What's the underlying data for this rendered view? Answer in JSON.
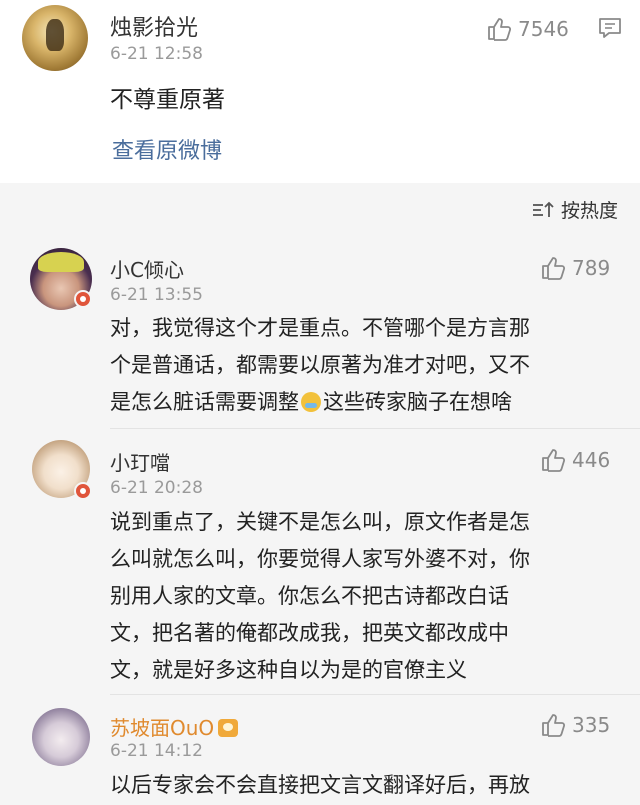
{
  "main_post": {
    "username": "烛影拾光",
    "timestamp": "6-21 12:58",
    "likes": "7546",
    "text": "不尊重原著",
    "view_original": "查看原微博"
  },
  "sort": {
    "label": "按热度"
  },
  "comments": [
    {
      "username": "小C倾心",
      "timestamp": "6-21 13:55",
      "likes": "789",
      "text_lines": [
        "对，我觉得这个才是重点。不管哪个是方言那",
        "个是普通话，都需要以原著为准才对吧，又不",
        "是怎么脏话需要调整",
        "这些砖家脑子在想啥"
      ]
    },
    {
      "username": "小玎噹",
      "timestamp": "6-21 20:28",
      "likes": "446",
      "text_lines": [
        "说到重点了，关键不是怎么叫，原文作者是怎",
        "么叫就怎么叫，你要觉得人家写外婆不对，你",
        "别用人家的文章。你怎么不把古诗都改白话",
        "文，把名著的俺都改成我，把英文都改成中",
        "文，就是好多这种自以为是的官僚主义"
      ]
    },
    {
      "username": "苏坡面OuO",
      "timestamp": "6-21 14:12",
      "likes": "335",
      "text_lines": [
        "以后专家会不会直接把文言文翻译好后，再放"
      ]
    }
  ],
  "colors": {
    "link": "#4a6d9c",
    "vip_name": "#e08a2e",
    "meta_gray": "#9a9a9a",
    "section_bg": "#f5f5f5"
  }
}
